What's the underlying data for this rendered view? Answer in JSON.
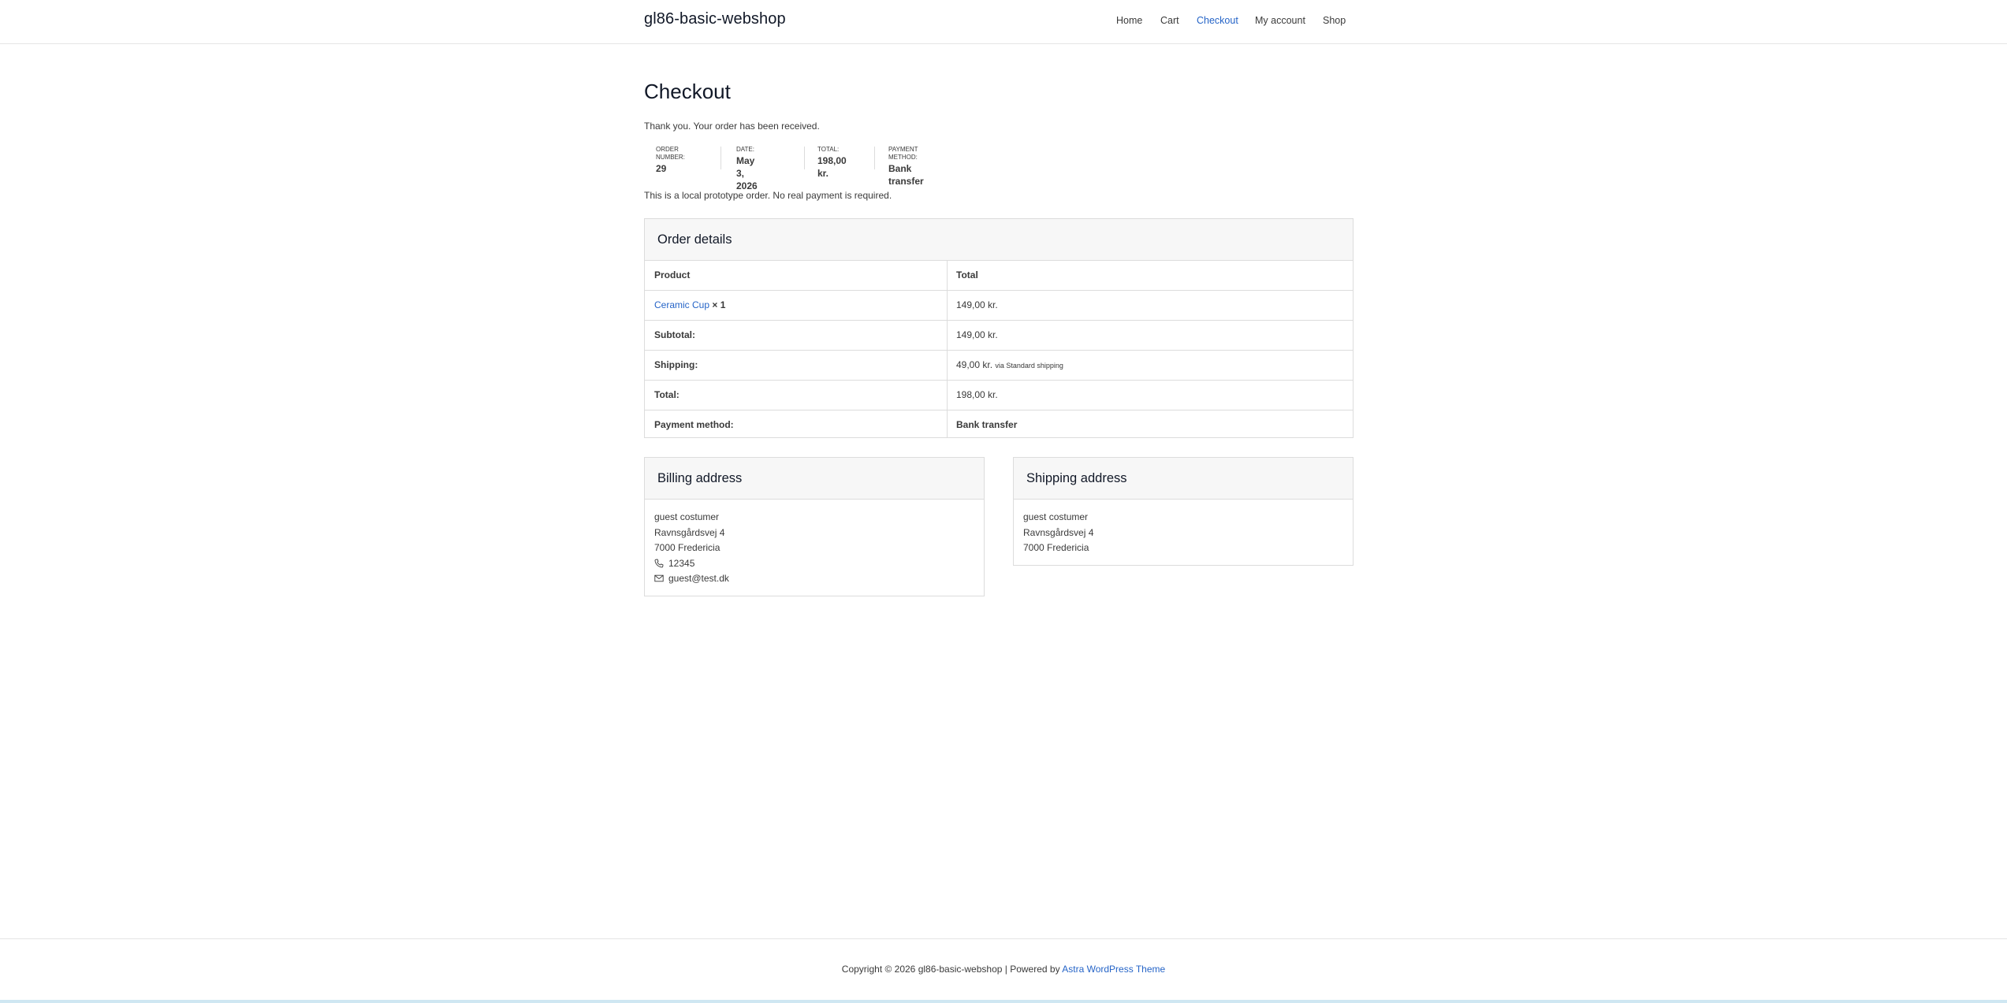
{
  "site": {
    "title": "gl86-basic-webshop"
  },
  "nav": {
    "items": [
      {
        "label": "Home",
        "active": false
      },
      {
        "label": "Cart",
        "active": false
      },
      {
        "label": "Checkout",
        "active": true
      },
      {
        "label": "My account",
        "active": false
      },
      {
        "label": "Shop",
        "active": false
      }
    ]
  },
  "page": {
    "title": "Checkout",
    "received_notice": "Thank you. Your order has been received.",
    "local_note": "This is a local prototype order. No real payment is required."
  },
  "overview": {
    "order_number_label": "Order number:",
    "order_number": "29",
    "date_label": "Date:",
    "date": "May 3, 2026",
    "total_label": "Total:",
    "total": "198,00 kr.",
    "payment_label": "Payment method:",
    "payment": "Bank transfer"
  },
  "order_details": {
    "heading": "Order details",
    "col_product": "Product",
    "col_total": "Total",
    "item_name": "Ceramic Cup",
    "item_qty": "× 1",
    "item_total": "149,00 kr.",
    "subtotal_label": "Subtotal:",
    "subtotal": "149,00 kr.",
    "shipping_label": "Shipping:",
    "shipping": "49,00 kr.",
    "shipping_via": "via Standard shipping",
    "total_label": "Total:",
    "total": "198,00 kr.",
    "payment_label": "Payment method:",
    "payment": "Bank transfer"
  },
  "billing": {
    "heading": "Billing address",
    "name": "guest costumer",
    "street": "Ravnsgårdsvej 4",
    "city": "7000 Fredericia",
    "phone": "12345",
    "email": "guest@test.dk"
  },
  "shipping": {
    "heading": "Shipping address",
    "name": "guest costumer",
    "street": "Ravnsgårdsvej 4",
    "city": "7000 Fredericia"
  },
  "footer": {
    "copyright": "Copyright © 2026 gl86-basic-webshop | Powered by ",
    "theme_link": "Astra WordPress Theme"
  },
  "colors": {
    "accent": "#2564c7",
    "text": "#3a3a3a",
    "heading": "#111827",
    "border": "#dcdcdc"
  }
}
